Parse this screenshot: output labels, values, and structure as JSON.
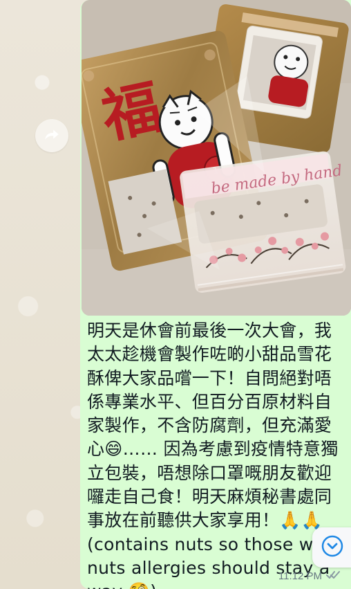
{
  "message": {
    "text": "明天是休會前最後一次大會，我太太趁機會製作咗啲小甜品雪花酥俾大家品嚐一下！自問絕對唔係專業水平、但百分百原材料自家製作，不含防腐劑，但充滿愛心😄…… 因為考慮到疫情特意獨立包裝，唔想除口罩嘅朋友歡迎囉走自己食！明天麻煩秘書處同事放在前聽供大家享用！🙏🙏 (contains nuts so those with nuts allergies should stay away 🧐)",
    "time": "11:12 PM",
    "status_icon": "double-check-icon"
  },
  "photo": {
    "label_text": "be made by hand",
    "wrapper_colors": {
      "gold": "#b08a4a",
      "red": "#b71c22",
      "pink": "#e7a7a7"
    }
  },
  "ui": {
    "forward_icon": "forward-icon",
    "scroll_icon": "chevron-down-icon",
    "bubble_color": "#d9fdd3",
    "wallpaper_color": "#e9e3d7"
  }
}
